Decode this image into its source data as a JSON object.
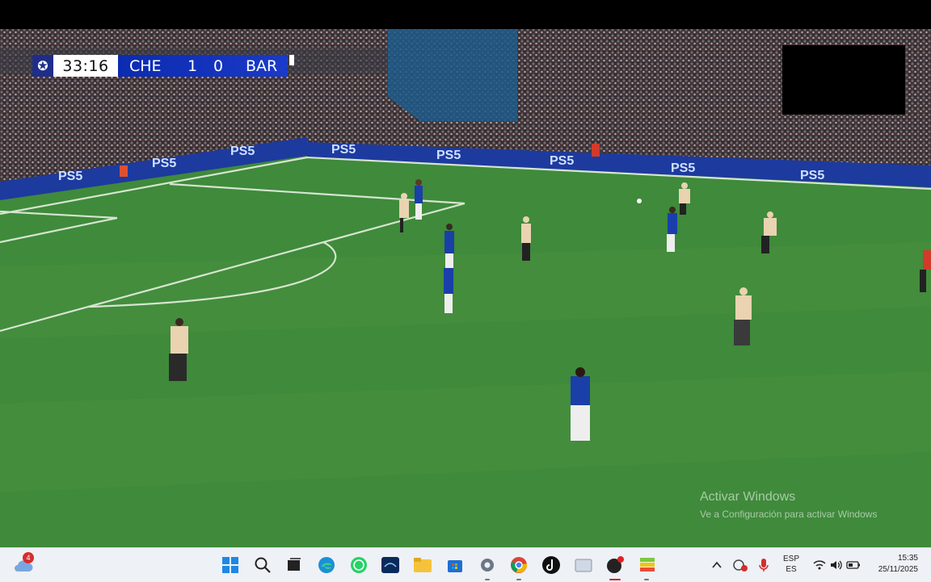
{
  "scoreboard": {
    "match_time": "33:16",
    "home_team": "CHE",
    "home_score": "1",
    "away_score": "0",
    "away_team": "BAR"
  },
  "ad_boards": [
    "PS5"
  ],
  "watermark": {
    "title": "Activar Windows",
    "subtitle": "Ve a Configuración para activar Windows"
  },
  "taskbar": {
    "weather_badge": "4",
    "pinned_apps": [
      "windows-start-icon",
      "search-icon",
      "task-view-icon",
      "edge-icon",
      "whatsapp-icon",
      "disney-plus-icon",
      "file-explorer-icon",
      "microsoft-store-icon",
      "settings-icon",
      "chrome-icon",
      "tiktok-icon",
      "notes-icon",
      "media-player-icon",
      "bluestacks-icon"
    ],
    "language_primary": "ESP",
    "language_secondary": "ES",
    "time": "15:35",
    "date": "25/11/2025"
  },
  "colors": {
    "pitch": "#3f8a3b",
    "board_blue": "#1d3a9e",
    "chelsea_kit": "#1a3fa8",
    "barcelona_kit": "#e9d3b0",
    "scoreboard_blue": "#1a3ac8"
  }
}
